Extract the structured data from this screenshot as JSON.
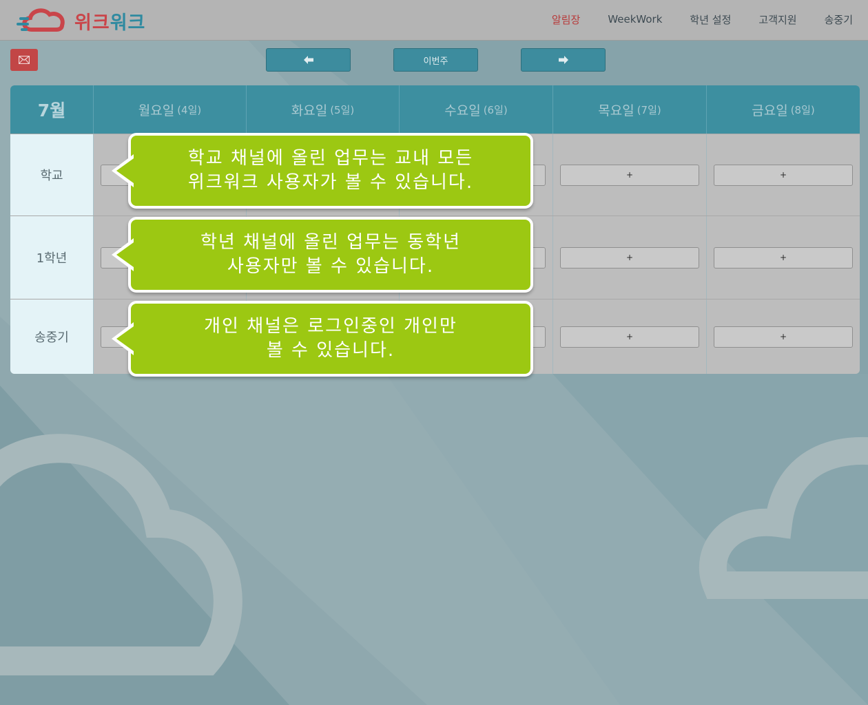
{
  "brand": {
    "logo_text_part1": "위크",
    "logo_text_part2": "워크",
    "colors": {
      "red": "#c9454a",
      "teal": "#2f8aa0",
      "bubble_green": "#9cc812"
    }
  },
  "nav": {
    "items": [
      {
        "label": "알림장",
        "active": true
      },
      {
        "label": "WeekWork"
      },
      {
        "label": "학년 설정"
      },
      {
        "label": "고객지원"
      },
      {
        "label": "송중기"
      }
    ]
  },
  "toolbar": {
    "mail_icon": "envelope-icon",
    "prev_icon": "arrow-left-icon",
    "this_week_label": "이번주",
    "next_icon": "arrow-right-icon"
  },
  "calendar": {
    "month": "7월",
    "days": [
      {
        "name": "월요일",
        "date": "(4일)"
      },
      {
        "name": "화요일",
        "date": "(5일)"
      },
      {
        "name": "수요일",
        "date": "(6일)"
      },
      {
        "name": "목요일",
        "date": "(7일)"
      },
      {
        "name": "금요일",
        "date": "(8일)"
      }
    ],
    "rows": [
      {
        "label": "학교"
      },
      {
        "label": "1학년"
      },
      {
        "label": "송중기"
      }
    ],
    "add_label": "+"
  },
  "tooltips": [
    {
      "line1": "학교 채널에 올린 업무는 교내 모든",
      "line2": "위크워크 사용자가 볼 수 있습니다."
    },
    {
      "line1": "학년 채널에 올린 업무는 동학년",
      "line2": "사용자만 볼 수 있습니다."
    },
    {
      "line1": "개인 채널은 로그인중인 개인만",
      "line2": "볼 수 있습니다."
    }
  ]
}
